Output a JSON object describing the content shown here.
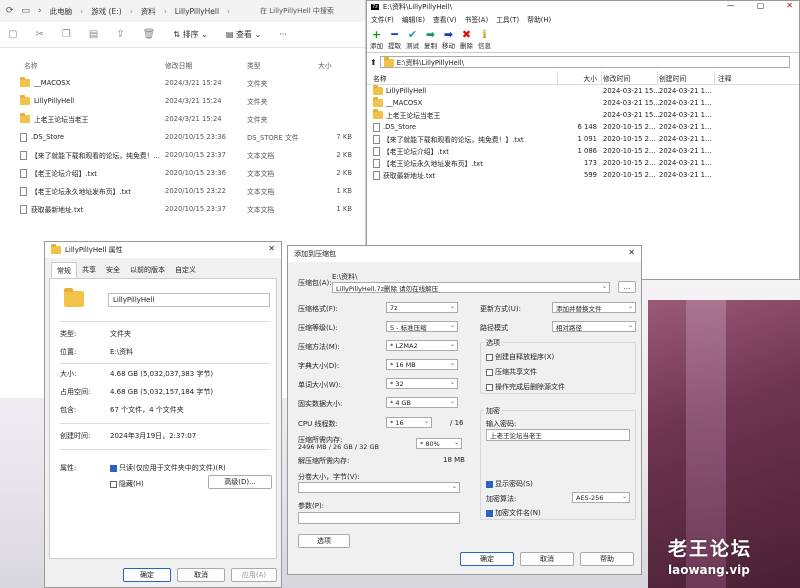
{
  "explorer": {
    "breadcrumb": [
      "此电脑",
      "游戏 (E:)",
      "资料",
      "LillyPillyHell"
    ],
    "search_placeholder": "在 LillyPillyHell 中搜索",
    "toolbar": {
      "sort": "排序",
      "view": "查看",
      "more": "···"
    },
    "columns": {
      "name": "名称",
      "date": "修改日期",
      "type": "类型",
      "size": "大小"
    },
    "rows": [
      {
        "name": "__MACOSX",
        "date": "2024/3/21 15:24",
        "type": "文件夹",
        "size": "",
        "folder": true
      },
      {
        "name": "LillyPillyHell",
        "date": "2024/3/21 15:24",
        "type": "文件夹",
        "size": "",
        "folder": true
      },
      {
        "name": "上老王论坛当老王",
        "date": "2024/3/21 15:24",
        "type": "文件夹",
        "size": "",
        "folder": true
      },
      {
        "name": ".DS_Store",
        "date": "2020/10/15 23:36",
        "type": "DS_STORE 文件",
        "size": "7 KB",
        "folder": false
      },
      {
        "name": "【来了就能下载和观看的论坛，纯免费！...",
        "date": "2020/10/15 23:37",
        "type": "文本文档",
        "size": "2 KB",
        "folder": false
      },
      {
        "name": "【老王论坛介绍】.txt",
        "date": "2020/10/15 23:36",
        "type": "文本文档",
        "size": "2 KB",
        "folder": false
      },
      {
        "name": "【老王论坛永久地址发布页】.txt",
        "date": "2020/10/15 23:22",
        "type": "文本文档",
        "size": "1 KB",
        "folder": false
      },
      {
        "name": "获取最新地址.txt",
        "date": "2020/10/15 23:37",
        "type": "文本文档",
        "size": "1 KB",
        "folder": false
      }
    ]
  },
  "zipfm": {
    "title": "E:\\资料\\LillyPillyHell\\",
    "logo": "7z",
    "menu": [
      "文件(F)",
      "编辑(E)",
      "查看(V)",
      "书签(A)",
      "工具(T)",
      "帮助(H)"
    ],
    "toolbar": [
      {
        "label": "添加",
        "glyph": "+",
        "color": "#1a9a1a"
      },
      {
        "label": "提取",
        "glyph": "━",
        "color": "#1a3fbf"
      },
      {
        "label": "测试",
        "glyph": "✔",
        "color": "#1aa0b0"
      },
      {
        "label": "复制",
        "glyph": "➡",
        "color": "#1a9a6a"
      },
      {
        "label": "移动",
        "glyph": "➡",
        "color": "#1a3fbf"
      },
      {
        "label": "删除",
        "glyph": "✖",
        "color": "#d01010"
      },
      {
        "label": "信息",
        "glyph": "ℹ",
        "color": "#c8a000"
      }
    ],
    "address": "E:\\资料\\LillyPillyHell\\",
    "columns": {
      "name": "名称",
      "size": "大小",
      "modified": "修改时间",
      "created": "创建时间",
      "note": "注释"
    },
    "rows": [
      {
        "name": "LillyPillyHell",
        "size": "",
        "modified": "2024-03-21 15...",
        "created": "2024-03-21 1...",
        "folder": true
      },
      {
        "name": "__MACOSX",
        "size": "",
        "modified": "2024-03-21 15...",
        "created": "2024-03-21 1...",
        "folder": true
      },
      {
        "name": "上老王论坛当老王",
        "size": "",
        "modified": "2024-03-21 15...",
        "created": "2024-03-21 1...",
        "folder": true
      },
      {
        "name": ".DS_Store",
        "size": "6 148",
        "modified": "2020-10-15 2...",
        "created": "2024-03-21 1...",
        "folder": false
      },
      {
        "name": "【来了就能下载和观看的论坛，纯免费！】.txt",
        "size": "1 091",
        "modified": "2020-10-15 2...",
        "created": "2024-03-21 1...",
        "folder": false
      },
      {
        "name": "【老王论坛介绍】.txt",
        "size": "1 086",
        "modified": "2020-10-15 2...",
        "created": "2024-03-21 1...",
        "folder": false
      },
      {
        "name": "【老王论坛永久地址发布页】.txt",
        "size": "173",
        "modified": "2020-10-15 2...",
        "created": "2024-03-21 1...",
        "folder": false
      },
      {
        "name": "获取最新地址.txt",
        "size": "599",
        "modified": "2020-10-15 2...",
        "created": "2024-03-21 1...",
        "folder": false
      }
    ]
  },
  "props": {
    "title": "LillyPillyHell 属性",
    "tabs": [
      "常规",
      "共享",
      "安全",
      "以前的版本",
      "自定义"
    ],
    "name": "LillyPillyHell",
    "type_label": "类型:",
    "type_value": "文件夹",
    "location_label": "位置:",
    "location_value": "E:\\资料",
    "size_label": "大小:",
    "size_value": "4.68 GB (5,032,037,383 字节)",
    "disk_label": "占用空间:",
    "disk_value": "4.68 GB (5,032,157,184 字节)",
    "contains_label": "包含:",
    "contains_value": "67 个文件，4 个文件夹",
    "created_label": "创建时间:",
    "created_value": "2024年3月19日，2:37:07",
    "attr_label": "属性:",
    "readonly": "只读(仅应用于文件夹中的文件)(R)",
    "hidden": "隐藏(H)",
    "advanced": "高级(D)...",
    "ok": "确定",
    "cancel": "取消",
    "apply": "应用(A)"
  },
  "addarc": {
    "title": "添加到压缩包",
    "archive_label": "压缩包(A):",
    "archive_dir": "E:\\资料\\",
    "archive_name": "LillyPillyHell.7z删除 请勿在线解压",
    "browse": "...",
    "format_label": "压缩格式(F):",
    "format": "7z",
    "level_label": "压缩等级(L):",
    "level": "5 - 标准压缩",
    "method_label": "压缩方法(M):",
    "method": "* LZMA2",
    "dict_label": "字典大小(D):",
    "dict": "* 16 MB",
    "word_label": "单词大小(W):",
    "word": "* 32",
    "solid_label": "固实数据大小:",
    "solid": "* 4 GB",
    "threads_label": "CPU 线程数:",
    "threads": "* 16",
    "threads_max": "/ 16",
    "mem_label": "压缩所需内存:",
    "mem_detail": "2496 MB / 26 GB / 32 GB",
    "mem_pct": "* 80%",
    "demem_label": "解压缩所需内存:",
    "demem": "18 MB",
    "split_label": "分卷大小，字节(V):",
    "params_label": "参数(P):",
    "options_btn": "选项",
    "update_label": "更新方式(U):",
    "update": "添加并替换文件",
    "path_label": "路径模式",
    "path": "相对路径",
    "opts_title": "选项",
    "opt_sfx": "创建自释放程序(X)",
    "opt_shared": "压缩共享文件",
    "opt_delete": "操作完成后删除源文件",
    "enc_title": "加密",
    "pwd_label": "输入密码:",
    "pwd": "上老王论坛当老王",
    "show_pwd": "显示密码(S)",
    "enc_method_label": "加密算法:",
    "enc_method": "AES-256",
    "enc_names": "加密文件名(N)",
    "ok": "确定",
    "cancel": "取消",
    "help": "帮助"
  },
  "watermark": {
    "big": "老王论坛",
    "small": "laowang.vip"
  }
}
